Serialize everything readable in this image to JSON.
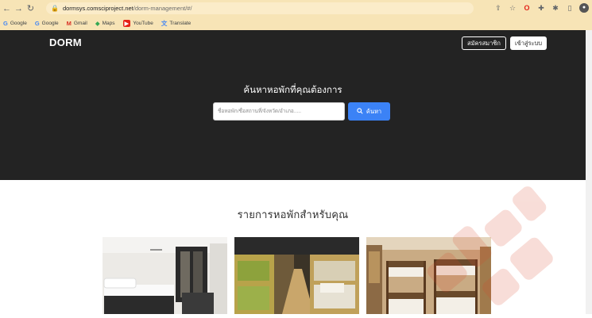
{
  "browser": {
    "url_host": "dormsys.comsciproject.net",
    "url_path": "/dorm-management/#/",
    "bookmarks": [
      "Google",
      "Google",
      "Gmail",
      "Maps",
      "YouTube",
      "Translate"
    ]
  },
  "navbar": {
    "brand": "DORM",
    "register_label": "สมัครสมาชิก",
    "login_label": "เข้าสู่ระบบ"
  },
  "hero": {
    "title": "ค้นหาหอพักที่คุณต้องการ",
    "search_placeholder": "ชื่อหอพัก/ชื่อสถานที่/จังหวัด/อำเภอ.....",
    "search_button": "ค้นหา"
  },
  "listing": {
    "title": "รายการหอพักสำหรับคุณ"
  },
  "colors": {
    "hero_bg": "#232323",
    "accent": "#3b82f6",
    "chrome_bg": "#f7e4b6"
  }
}
